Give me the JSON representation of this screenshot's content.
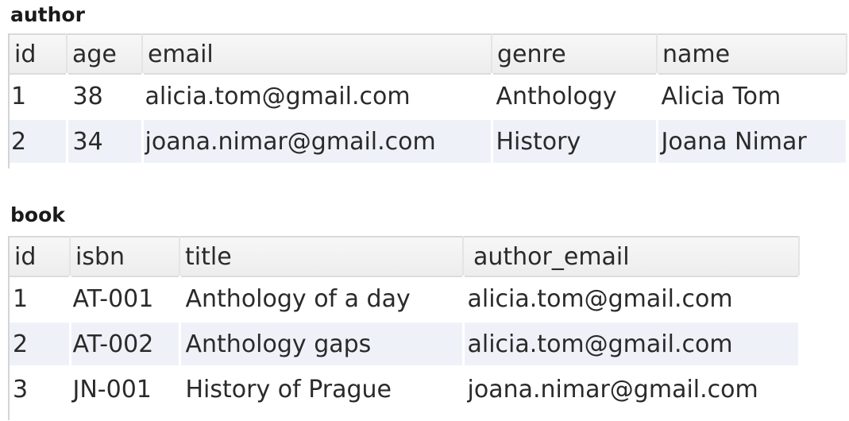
{
  "author": {
    "title": "author",
    "columns": [
      "id",
      "age",
      "email",
      "genre",
      "name"
    ],
    "rows": [
      [
        "1",
        "38",
        "alicia.tom@gmail.com",
        "Anthology",
        "Alicia Tom"
      ],
      [
        "2",
        "34",
        "joana.nimar@gmail.com",
        "History",
        "Joana Nimar"
      ]
    ]
  },
  "book": {
    "title": "book",
    "columns": [
      "id",
      "isbn",
      "title",
      "author_email"
    ],
    "rows": [
      [
        "1",
        "AT-001",
        "Anthology of a day",
        "alicia.tom@gmail.com"
      ],
      [
        "2",
        "AT-002",
        "Anthology gaps",
        "alicia.tom@gmail.com"
      ],
      [
        "3",
        "JN-001",
        "History of Prague",
        "joana.nimar@gmail.com"
      ]
    ]
  },
  "colors": {
    "header_bg": "#efefef",
    "row_alt_bg": "#eef2f8",
    "text": "#2a2a2a"
  }
}
